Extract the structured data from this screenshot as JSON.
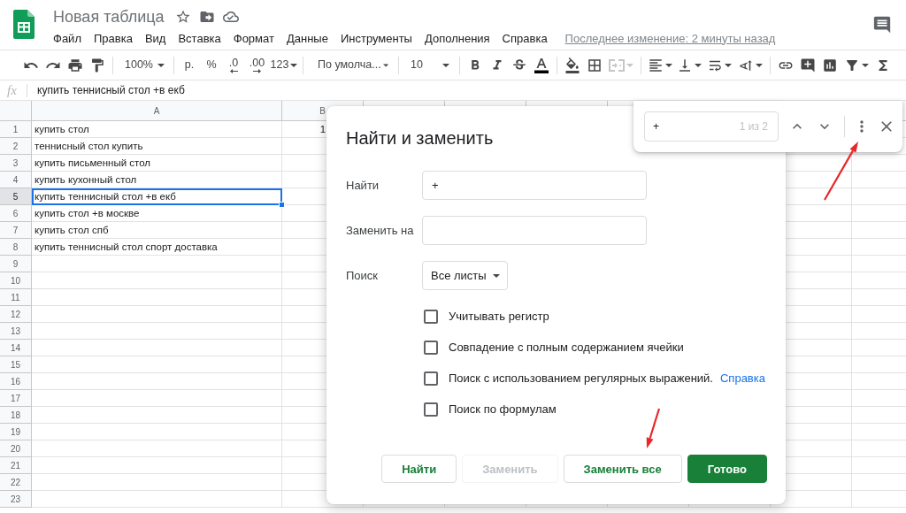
{
  "app": {
    "title": "Новая таблица",
    "menu": [
      "Файл",
      "Правка",
      "Вид",
      "Вставка",
      "Формат",
      "Данные",
      "Инструменты",
      "Дополнения",
      "Справка"
    ],
    "last_edit": "Последнее изменение: 2 минуты назад"
  },
  "toolbar": {
    "zoom": "100%",
    "currency": "р.",
    "percent": "%",
    "decrease_decimals": ".0",
    "increase_decimals": ".00",
    "number_format": "123",
    "font": "По умолча...",
    "font_size": "10",
    "merge": {
      "disabled": true
    }
  },
  "formula_bar": {
    "label": "fx",
    "value": "купить теннисный стол +в екб"
  },
  "sheet": {
    "columns": [
      "A",
      "B"
    ],
    "rows": [
      {
        "number": "1",
        "cells": [
          "купить стол",
          "1"
        ],
        "selected": false
      },
      {
        "number": "2",
        "cells": [
          "теннисный стол купить"
        ],
        "selected": false
      },
      {
        "number": "3",
        "cells": [
          "купить письменный стол"
        ],
        "selected": false
      },
      {
        "number": "4",
        "cells": [
          "купить кухонный стол"
        ],
        "selected": false
      },
      {
        "number": "5",
        "cells": [
          "купить теннисный стол +в екб"
        ],
        "selected": true
      },
      {
        "number": "6",
        "cells": [
          "купить стол +в москве"
        ],
        "selected": false
      },
      {
        "number": "7",
        "cells": [
          "купить стол спб"
        ],
        "selected": false
      },
      {
        "number": "8",
        "cells": [
          "купить теннисный стол спорт доставка"
        ],
        "selected": false
      },
      {
        "number": "9",
        "selected": false
      },
      {
        "number": "10",
        "selected": false
      },
      {
        "number": "11",
        "selected": false
      },
      {
        "number": "12",
        "selected": false
      },
      {
        "number": "13",
        "selected": false
      },
      {
        "number": "14",
        "selected": false
      },
      {
        "number": "15",
        "selected": false
      },
      {
        "number": "16",
        "selected": false
      },
      {
        "number": "17",
        "selected": false
      },
      {
        "number": "18",
        "selected": false
      },
      {
        "number": "19",
        "selected": false
      },
      {
        "number": "20",
        "selected": false
      },
      {
        "number": "21",
        "selected": false
      },
      {
        "number": "22",
        "selected": false
      },
      {
        "number": "23",
        "selected": false
      }
    ]
  },
  "find_bar": {
    "query": "+",
    "count": "1 из 2"
  },
  "dialog": {
    "title": "Найти и заменить",
    "find": {
      "label": "Найти",
      "value": "+"
    },
    "replace": {
      "label": "Заменить на"
    },
    "scope": {
      "label": "Поиск",
      "value": "Все листы"
    },
    "options": [
      {
        "label": "Учитывать регистр",
        "checked": false
      },
      {
        "label": "Совпадение с полным содержанием ячейки",
        "checked": false
      },
      {
        "label": "Поиск с использованием регулярных выражений.",
        "checked": false,
        "link": "Справка"
      },
      {
        "label": "Поиск по формулам",
        "checked": false
      }
    ],
    "buttons": [
      {
        "label": "Найти",
        "kind": "default",
        "disabled": false
      },
      {
        "label": "Заменить",
        "kind": "default",
        "disabled": true
      },
      {
        "label": "Заменить все",
        "kind": "default",
        "disabled": false
      },
      {
        "label": "Готово",
        "kind": "primary",
        "disabled": false
      }
    ]
  }
}
